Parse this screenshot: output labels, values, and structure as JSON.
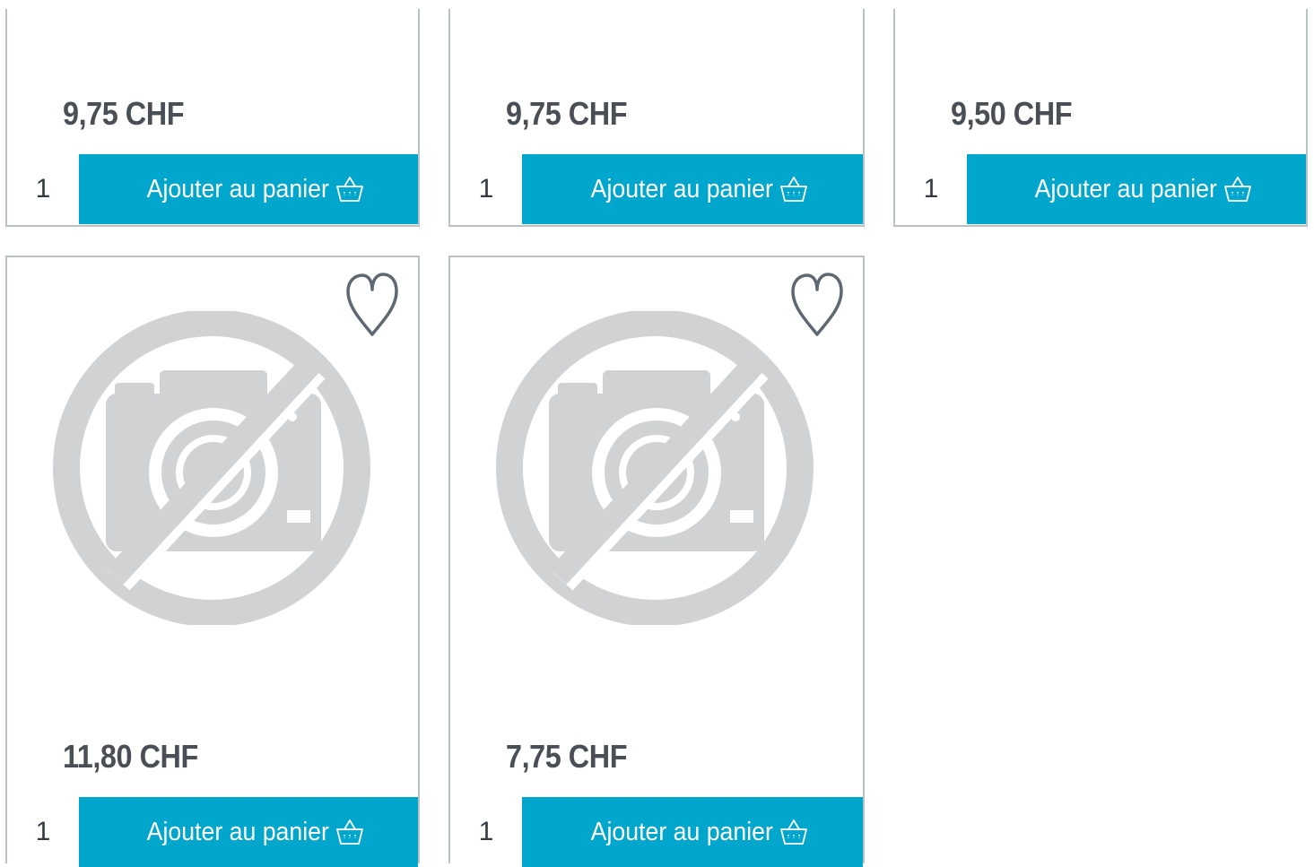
{
  "products": [
    {
      "price": "9,75 CHF",
      "quantity": "1",
      "add_label": "Ajouter au panier"
    },
    {
      "price": "9,75 CHF",
      "quantity": "1",
      "add_label": "Ajouter au panier"
    },
    {
      "price": "9,50 CHF",
      "quantity": "1",
      "add_label": "Ajouter au panier"
    },
    {
      "price": "11,80 CHF",
      "quantity": "1",
      "add_label": "Ajouter au panier",
      "image": "no-image-placeholder-icon",
      "wishlist": "heart-icon"
    },
    {
      "price": "7,75 CHF",
      "quantity": "1",
      "add_label": "Ajouter au panier",
      "image": "no-image-placeholder-icon",
      "wishlist": "heart-icon"
    }
  ],
  "colors": {
    "button": "#00a6cc",
    "border": "#b9c1c7",
    "price_text": "#4a4f55",
    "placeholder": "#d0d2d4",
    "heart": "#5e6872"
  }
}
